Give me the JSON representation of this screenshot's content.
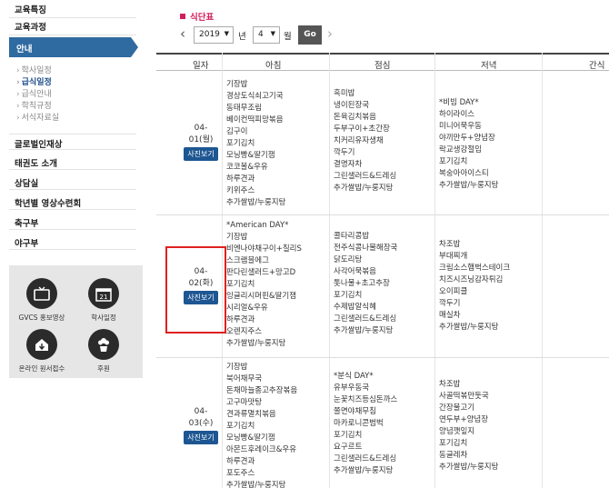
{
  "sidebar": {
    "items_top": [
      "교육특징",
      "교육과정"
    ],
    "active": "안내",
    "sub_items": [
      {
        "label": "학사일정",
        "on": false
      },
      {
        "label": "급식일정",
        "on": true
      },
      {
        "label": "급식안내",
        "on": false
      },
      {
        "label": "학칙규정",
        "on": false
      },
      {
        "label": "서식자료실",
        "on": false
      }
    ],
    "items_bottom": [
      "글로벌인재상",
      "태권도 소개",
      "상담실",
      "학년별 영상수련회",
      "축구부",
      "야구부"
    ]
  },
  "quick": [
    {
      "label": "GVCS 홍보영상",
      "icon": "tv-icon"
    },
    {
      "label": "학사일정",
      "icon": "calendar-icon",
      "num": "21"
    },
    {
      "label": "온라인 원서접수",
      "icon": "house-icon"
    },
    {
      "label": "후원",
      "icon": "plant-icon"
    }
  ],
  "page": {
    "title": "식단표"
  },
  "nav": {
    "year": "2019",
    "year_unit": "년",
    "month": "4",
    "month_unit": "월",
    "go": "Go"
  },
  "table": {
    "headers": [
      "일자",
      "아침",
      "점심",
      "저녁",
      "간식"
    ],
    "photo_label": "사진보기",
    "rows": [
      {
        "date1": "04-",
        "date2": "01(월)",
        "breakfast": [
          "기장밥",
          "경상도식쇠고기국",
          "동태무조림",
          "베이컨떡피망볶음",
          "김구이",
          "포기김치",
          "모닝빵&딸기잼",
          "코코볼&우유",
          "하루견과",
          "키위주스",
          "추가쌀밥/누룽지탕"
        ],
        "lunch": [
          "흑미밥",
          "냉이된장국",
          "돈육김치볶음",
          "두부구이+초간장",
          "치커리유자생채",
          "깍두기",
          "결명자차",
          "그린샐러드&드레싱",
          "추가쌀밥/누룽지탕"
        ],
        "dinner": [
          "*비빔 DAY*",
          "하이라이스",
          "미니어묵우동",
          "야끼만두+양념장",
          "락교생강절임",
          "포기김치",
          "복숭아아이스티",
          "추가쌀밥/누룽지탕"
        ]
      },
      {
        "date1": "04-",
        "date2": "02(화)",
        "breakfast": [
          "*American DAY*",
          "기장밥",
          "비엔나야채구이+칠리S",
          "스크램블에그",
          "판다린샐러드+망고D",
          "포기김치",
          "잉글리시머핀&딸기잼",
          "시리얼&우유",
          "하루견과",
          "오렌지주스",
          "추가쌀밥/누룽지탕"
        ],
        "lunch": [
          "콜타리콩밥",
          "전주식콩나물해장국",
          "닭도리탕",
          "사각어묵볶음",
          "톳나물+초고추장",
          "포기김치",
          "수제밥알식혜",
          "그린샐러드&드레싱",
          "추가쌀밥/누룽지탕"
        ],
        "dinner": [
          "차조밥",
          "부대찌개",
          "크림소스햄벅스테이크",
          "치즈시즈닝감자튀김",
          "오이피클",
          "깍두기",
          "매실차",
          "추가쌀밥/누룽지탕"
        ]
      },
      {
        "date1": "04-",
        "date2": "03(수)",
        "breakfast": [
          "기장밥",
          "북어채무국",
          "돈채마늘종고추장볶음",
          "고구마맛탕",
          "견과류멸치볶음",
          "포기김치",
          "모닝빵&딸기잼",
          "아몬드후레이크&우유",
          "하루견과",
          "포도주스",
          "추가쌀밥/누룽지탕"
        ],
        "lunch": [
          "*분식 DAY*",
          "유부우동국",
          "눈꽃치즈등심돈까스",
          "쫄면야채무침",
          "마카로니콘범벅",
          "포기김치",
          "요구르트",
          "그린샐러드&드레싱",
          "추가쌀밥/누룽지탕"
        ],
        "dinner": [
          "차조밥",
          "사골떡볶만둣국",
          "간장불고기",
          "연두부+양념장",
          "양념깻잎지",
          "포기김치",
          "동글레차",
          "추가쌀밥/누룽지탕"
        ]
      }
    ]
  },
  "colors": {
    "accent": "#2f6aa1",
    "title": "#d21f5b",
    "button": "#1d5692",
    "highlight": "#e02020"
  }
}
